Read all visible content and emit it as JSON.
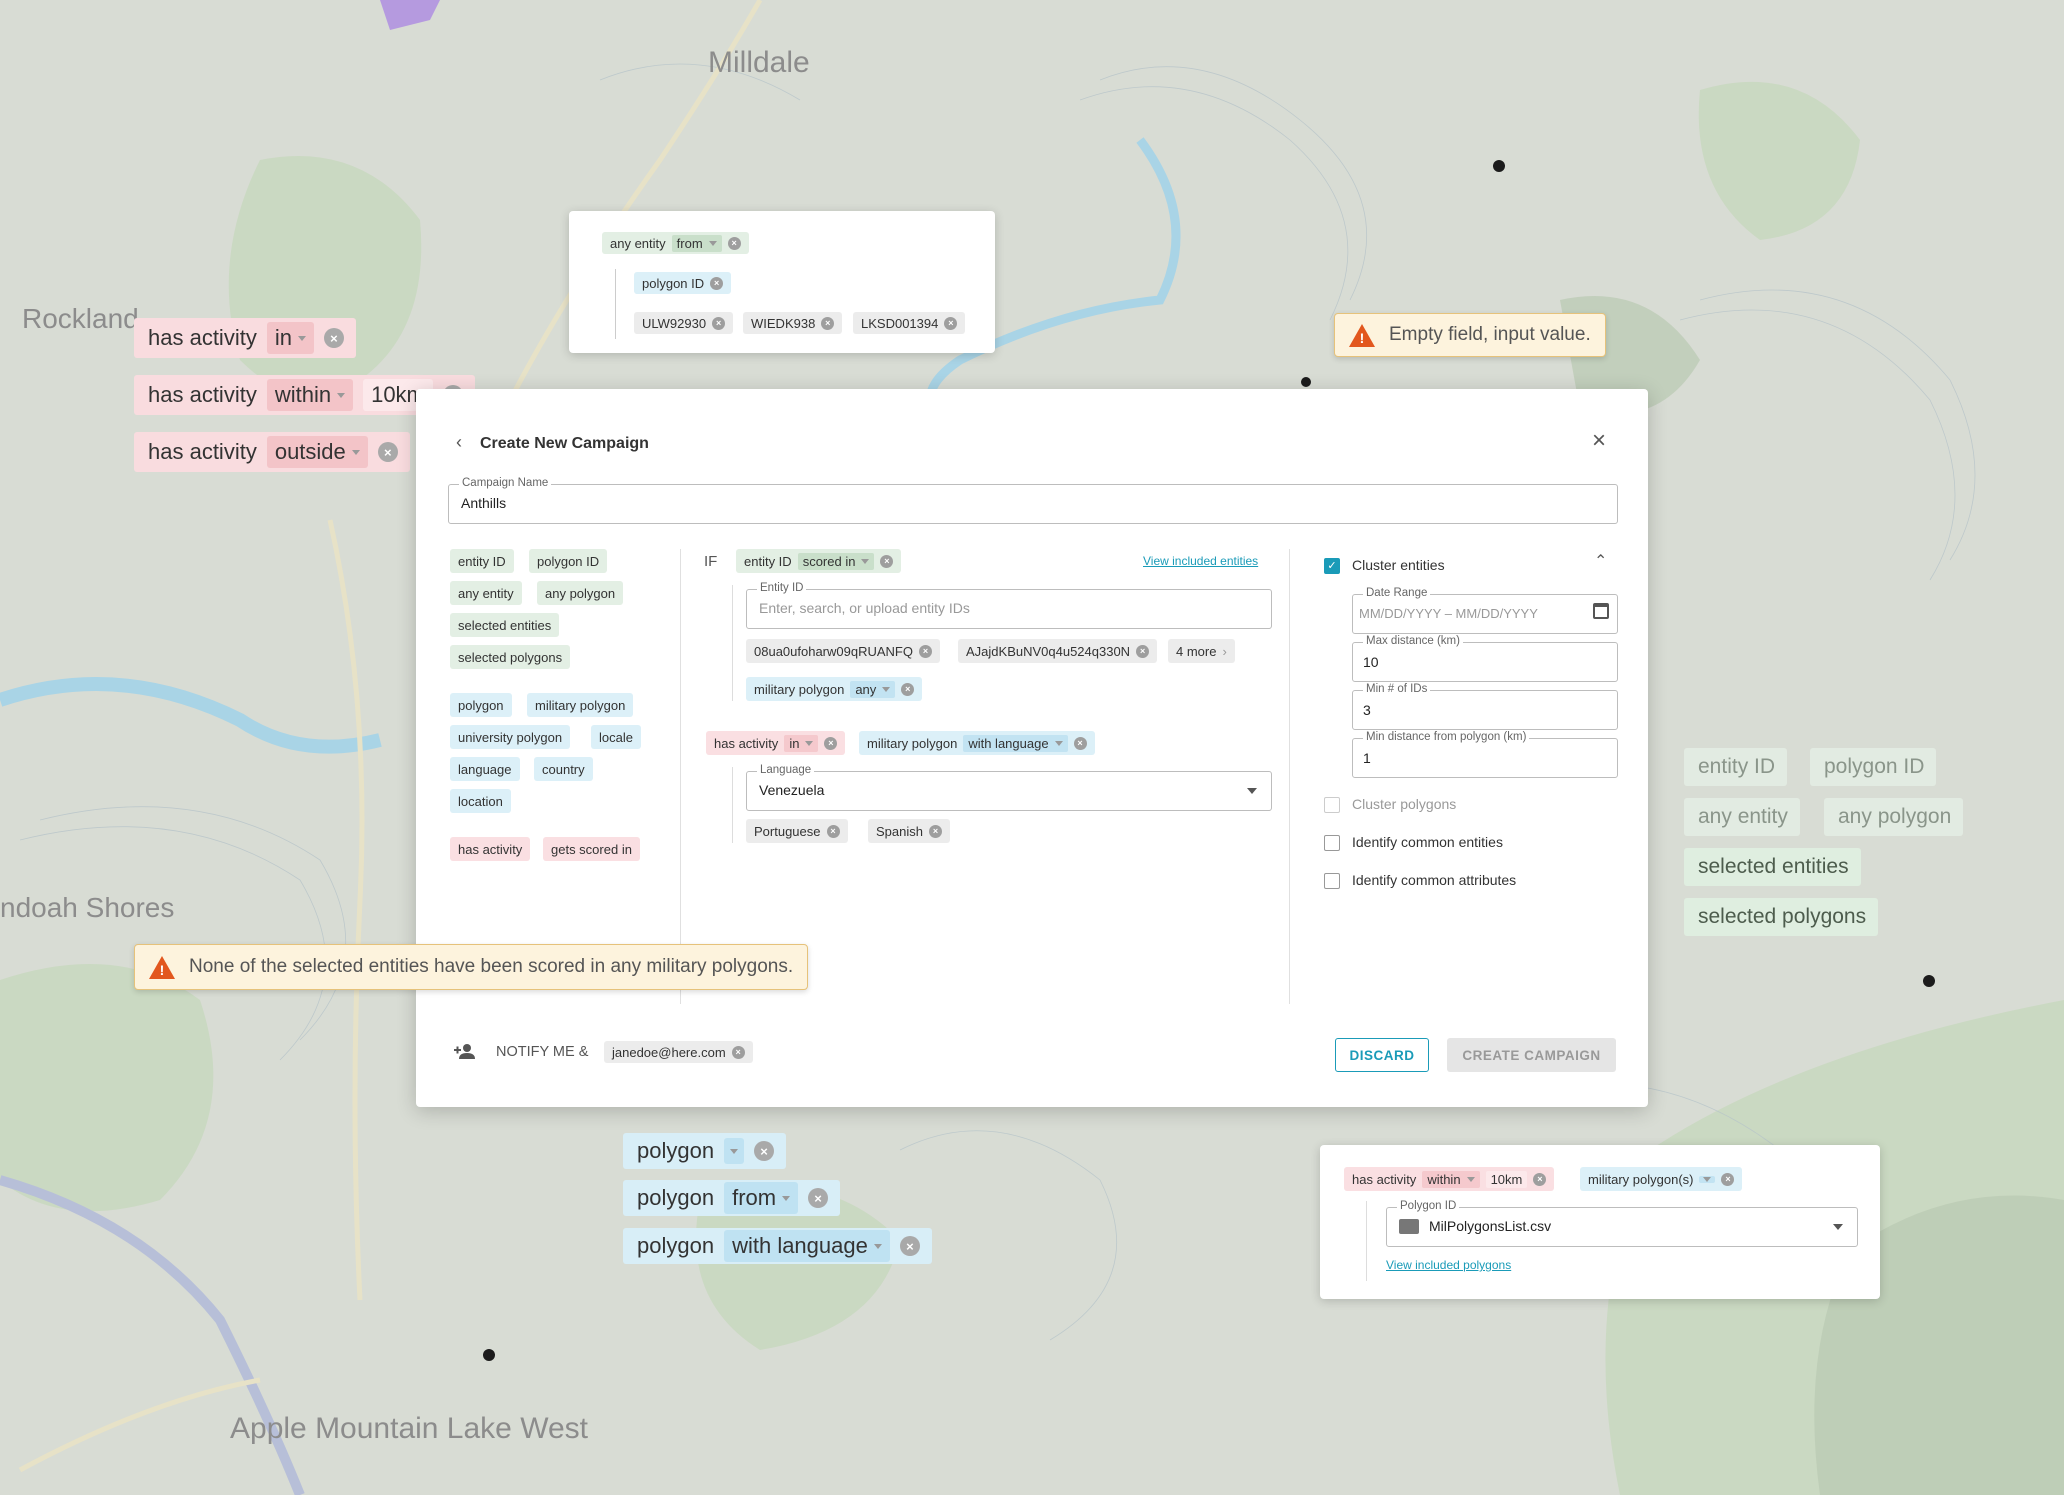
{
  "map": {
    "places": [
      "Milldale",
      "Rockland",
      "ndoah Shores",
      "Apple Mountain Lake West"
    ]
  },
  "left_chips": [
    {
      "text": "has activity",
      "op": "in"
    },
    {
      "text": "has activity",
      "op": "within",
      "value": "10km"
    },
    {
      "text": "has activity",
      "op": "outside"
    }
  ],
  "top_card": {
    "row1": {
      "text": "any entity",
      "op": "from"
    },
    "row2": {
      "text": "polygon ID"
    },
    "ids": [
      "ULW92930",
      "WIEDK938",
      "LKSD001394"
    ]
  },
  "toast_top": "Empty field, input value.",
  "toast_bottom": "None of the selected entities have been scored in any military polygons.",
  "right_chips": [
    "entity ID",
    "polygon ID",
    "any entity",
    "any polygon",
    "selected entities",
    "selected polygons"
  ],
  "bottom_chips": [
    {
      "text": "polygon",
      "op": ""
    },
    {
      "text": "polygon",
      "op": "from"
    },
    {
      "text": "polygon",
      "op": "with language"
    }
  ],
  "br_card": {
    "chip1": {
      "text": "has activity",
      "op": "within",
      "value": "10km"
    },
    "chip2": {
      "text": "military polygon(s)"
    },
    "polygon_id_label": "Polygon ID",
    "polygon_id_value": "MilPolygonsList.csv",
    "link": "View included polygons"
  },
  "modal": {
    "title": "Create New Campaign",
    "campaign_name_label": "Campaign Name",
    "campaign_name_value": "Anthills",
    "palette_group1": [
      "entity ID",
      "polygon ID",
      "any entity",
      "any polygon",
      "selected entities",
      "selected polygons"
    ],
    "palette_group2": [
      "polygon",
      "military polygon",
      "university polygon",
      "locale",
      "language",
      "country",
      "location"
    ],
    "palette_group3": [
      "has activity",
      "gets scored in"
    ],
    "if_label": "IF",
    "rule1": {
      "text": "entity ID",
      "op": "scored in"
    },
    "view_entities_link": "View included entities",
    "entity_id_label": "Entity ID",
    "entity_id_placeholder": "Enter, search, or upload entity IDs",
    "entity_chips": [
      "08ua0ufoharw09qRUANFQ",
      "AJajdKBuNV0q4u524q330N"
    ],
    "more_chip": "4 more",
    "rule1b": {
      "text": "military polygon",
      "op": "any"
    },
    "rule2a": {
      "text": "has activity",
      "op": "in"
    },
    "rule2b": {
      "text": "military polygon",
      "op": "with language"
    },
    "language_label": "Language",
    "language_value": "Venezuela",
    "language_chips": [
      "Portuguese",
      "Spanish"
    ],
    "cluster_entities": "Cluster entities",
    "date_range_label": "Date Range",
    "date_range_placeholder": "MM/DD/YYYY – MM/DD/YYYY",
    "max_distance_label": "Max distance (km)",
    "max_distance_value": "10",
    "min_ids_label": "Min # of IDs",
    "min_ids_value": "3",
    "min_dist_poly_label": "Min distance from polygon (km)",
    "min_dist_poly_value": "1",
    "cluster_polygons": "Cluster polygons",
    "identify_entities": "Identify common entities",
    "identify_attributes": "Identify common attributes",
    "notify_label": "NOTIFY ME &",
    "notify_email": "janedoe@here.com",
    "discard": "DISCARD",
    "create": "CREATE CAMPAIGN"
  }
}
